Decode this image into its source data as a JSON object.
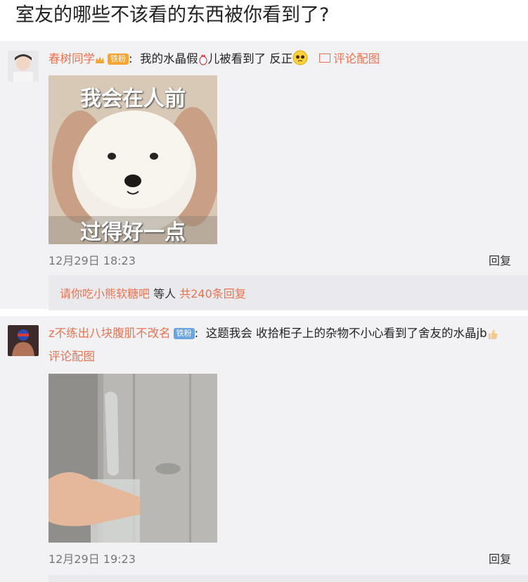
{
  "question": {
    "title": "室友的哪些不该看的东西被你看到了?"
  },
  "comments": [
    {
      "user": "春树同学",
      "badge": "铁粉",
      "colon": ":",
      "text_a": "我的水晶假",
      "text_b": "儿被看到了 反正",
      "link": "评论配图",
      "image_text_top": "我会在人前",
      "image_text_bottom": "过得好一点",
      "date": "12月29日 18:23",
      "reply_label": "回复",
      "sub_reply": {
        "user": "请你吃小熊软糖吧",
        "text": "等人",
        "count": "共240条回复"
      }
    },
    {
      "user": "z不练出八块腹肌不改名",
      "badge": "铁粉",
      "colon": ":",
      "text": "这题我会 收拾柜子上的杂物不小心看到了舍友的水晶jb",
      "link": "评论配图",
      "date": "12月29日 19:23",
      "reply_label": "回复"
    }
  ],
  "colors": {
    "accent": "#eb7350",
    "background": "#f2f2f5"
  }
}
